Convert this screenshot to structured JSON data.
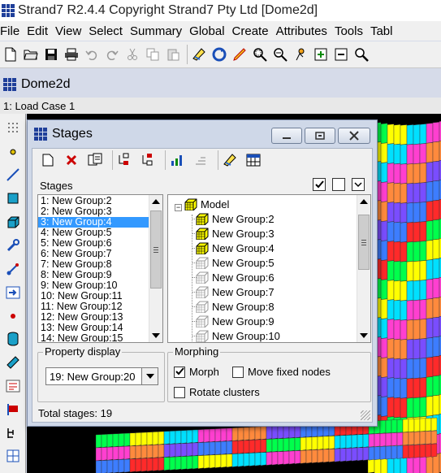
{
  "window": {
    "title": "Strand7 R2.4.4 Copyright Strand7 Pty Ltd [Dome2d]"
  },
  "menu": [
    "File",
    "Edit",
    "View",
    "Select",
    "Summary",
    "Global",
    "Create",
    "Attributes",
    "Tools",
    "Tabl"
  ],
  "toolbar": {
    "icons": [
      "new-file-icon",
      "open-folder-icon",
      "save-icon",
      "print-icon",
      "undo-icon",
      "redo-icon",
      "cut-icon",
      "copy-icon",
      "paste-icon",
      "render-icon",
      "refresh-icon",
      "pencil-icon",
      "zoom-fit-icon",
      "zoom-window-icon",
      "rotate-icon",
      "zoom-in-icon",
      "zoom-out-icon",
      "magnifier-icon"
    ]
  },
  "document": {
    "tab_label": "Dome2d",
    "load_case": "1: Load Case 1"
  },
  "left_tools": {
    "icons": [
      "dots-grid-icon",
      "node-icon",
      "beam-icon",
      "plate-icon",
      "brick-icon",
      "wrench-icon",
      "link-icon",
      "arrow-right-icon",
      "point-icon",
      "cylinder-icon",
      "ruler-icon",
      "dialog-icon",
      "flag-icon",
      "tree-icon",
      "grid-icon"
    ]
  },
  "stages_dialog": {
    "title": "Stages",
    "toolbar_icons": [
      "new-stage-icon",
      "delete-icon",
      "copy-stage-icon",
      "move-up-icon",
      "move-down-icon",
      "bar-chart-icon",
      "sort-icon",
      "render-icon",
      "table-icon"
    ],
    "stages_label": "Stages",
    "stages": [
      "1: New Group:2",
      "2: New Group:3",
      "3: New Group:4",
      "4: New Group:5",
      "5: New Group:6",
      "6: New Group:7",
      "7: New Group:8",
      "8: New Group:9",
      "9: New Group:10",
      "10: New Group:11",
      "11: New Group:12",
      "12: New Group:13",
      "13: New Group:14",
      "14: New Group:15"
    ],
    "selected_stage_index": 2,
    "tree": {
      "root": "Model",
      "expander": "−",
      "groups": [
        {
          "label": "New Group:2",
          "active": true
        },
        {
          "label": "New Group:3",
          "active": true
        },
        {
          "label": "New Group:4",
          "active": true
        },
        {
          "label": "New Group:5",
          "active": false
        },
        {
          "label": "New Group:6",
          "active": false
        },
        {
          "label": "New Group:7",
          "active": false
        },
        {
          "label": "New Group:8",
          "active": false
        },
        {
          "label": "New Group:9",
          "active": false
        },
        {
          "label": "New Group:10",
          "active": false
        }
      ]
    },
    "visibility_boxes": [
      "check",
      "empty",
      "arrow"
    ],
    "property_display": {
      "label": "Property display",
      "value": "19: New Group:20"
    },
    "morphing": {
      "label": "Morphing",
      "morph": {
        "label": "Morph",
        "checked": true
      },
      "move_fixed_nodes": {
        "label": "Move fixed nodes",
        "checked": false
      },
      "rotate_clusters": {
        "label": "Rotate clusters",
        "checked": false
      }
    },
    "total_stages": "Total stages: 19"
  },
  "colors": {
    "accent_selection": "#3399ff",
    "brand_blue": "#1f3f9a",
    "viewport_bg": "#000000",
    "mesh_colors": [
      "#00ff4c",
      "#ffff00",
      "#00e0ff",
      "#ff3fd0",
      "#ff8a3d",
      "#7a4dff",
      "#3d7dff",
      "#ff2a2a"
    ]
  }
}
